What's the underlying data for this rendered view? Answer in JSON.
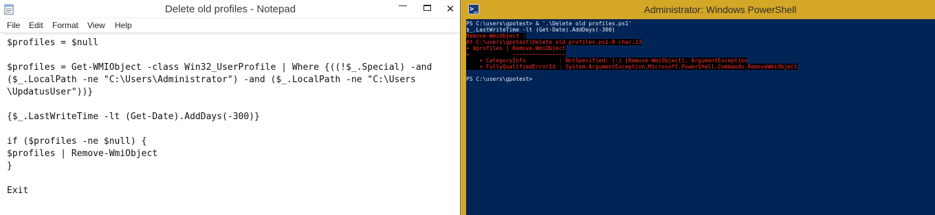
{
  "notepad": {
    "title": "Delete old profiles - Notepad",
    "minimize_glyph": "—",
    "close_glyph": "✕",
    "menu": [
      "File",
      "Edit",
      "Format",
      "View",
      "Help"
    ],
    "content": "$profiles = $null\n\n$profiles = Get-WMIObject -class Win32_UserProfile | Where {((!$_.Special) -and\n($_.LocalPath -ne \"C:\\Users\\Administrator\") -and ($_.LocalPath -ne \"C:\\Users\n\\UpdatusUser\"))}\n\n{$_.LastWriteTime -lt (Get-Date).AddDays(-300)}\n\nif ($profiles -ne $null) {\n$profiles | Remove-WmiObject\n}\n\nExit"
  },
  "powershell": {
    "title": "Administrator: Windows PowerShell",
    "icon_glyph": ">_",
    "lines": [
      {
        "text": "PS C:\\users\\gpotest> & '.\\Delete old profiles.ps1'",
        "kind": "out"
      },
      {
        "text": "$_.LastWriteTime -lt (Get-Date).AddDays(-300)",
        "kind": "out"
      },
      {
        "text": "Remove-WmiObject :",
        "kind": "err"
      },
      {
        "text": "At C:\\users\\gpotest\\Delete old profiles.ps1:8 char:13",
        "kind": "err"
      },
      {
        "text": "+ $profiles | Remove-WmiObject",
        "kind": "err"
      },
      {
        "text": "+             ~~~~~~~~~~~~~~~~",
        "kind": "err"
      },
      {
        "text": "    + CategoryInfo          : NotSpecified: (:) [Remove-WmiObject], ArgumentException",
        "kind": "err"
      },
      {
        "text": "    + FullyQualifiedErrorId : System.ArgumentException,Microsoft.PowerShell.Commands.RemoveWmiObject",
        "kind": "err"
      },
      {
        "text": "",
        "kind": "blank"
      },
      {
        "text": "PS C:\\users\\gpotest>",
        "kind": "out"
      }
    ]
  },
  "colors": {
    "powershell_background": "#012456",
    "powershell_frame": "#d5a726",
    "error_text": "#ff3030",
    "output_text": "#eeedf0"
  }
}
